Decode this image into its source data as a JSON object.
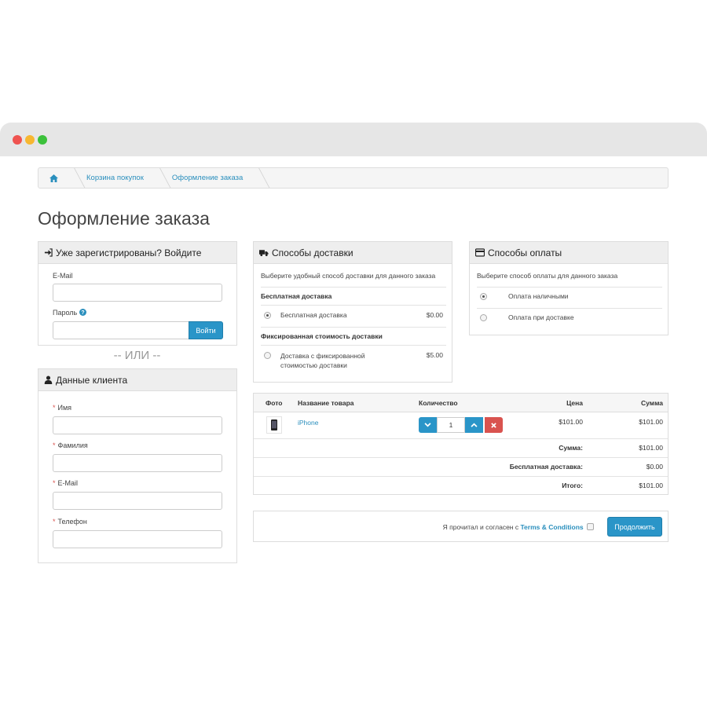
{
  "breadcrumb": {
    "home_icon": "home-icon",
    "items": [
      "Корзина покупок",
      "Оформление заказа"
    ]
  },
  "page_title": "Оформление заказа",
  "login": {
    "heading": "Уже зарегистрированы? Войдите",
    "heading_icon": "sign-in-icon",
    "email_label": "E-Mail",
    "email_value": "",
    "password_label": "Пароль",
    "password_help_icon": "question-circle-icon",
    "password_value": "",
    "login_button": "Войти"
  },
  "or_text": "-- ИЛИ --",
  "customer": {
    "heading": "Данные клиента",
    "heading_icon": "user-icon",
    "required_marker": "*",
    "fields": [
      {
        "label": "Имя",
        "value": ""
      },
      {
        "label": "Фамилия",
        "value": ""
      },
      {
        "label": "E-Mail",
        "value": ""
      },
      {
        "label": "Телефон",
        "value": ""
      }
    ]
  },
  "shipping": {
    "heading": "Способы доставки",
    "heading_icon": "truck-icon",
    "description": "Выберите удобный способ доставки для данного заказа",
    "groups": [
      {
        "title": "Бесплатная доставка",
        "option": "Бесплатная доставка",
        "price": "$0.00",
        "selected": true
      },
      {
        "title": "Фиксированная стоимость доставки",
        "option_line1": "Доставка с фиксированной",
        "option_line2": "стоимостью доставки",
        "price": "$5.00",
        "selected": false
      }
    ]
  },
  "payment": {
    "heading": "Способы оплаты",
    "heading_icon": "credit-card-icon",
    "description": "Выберите способ оплаты для данного заказа",
    "options": [
      {
        "label": "Оплата наличными",
        "selected": true
      },
      {
        "label": "Оплата при доставке",
        "selected": false
      }
    ]
  },
  "cart": {
    "columns": {
      "photo": "Фото",
      "name": "Название товара",
      "qty": "Количество",
      "price": "Цена",
      "total": "Сумма"
    },
    "items": [
      {
        "image_icon": "phone-icon",
        "name": "iPhone",
        "qty": "1",
        "price": "$101.00",
        "total": "$101.00"
      }
    ],
    "qty_buttons": {
      "decrease_icon": "chevron-down-icon",
      "increase_icon": "chevron-up-icon",
      "remove_icon": "close-icon"
    },
    "totals": [
      {
        "label": "Сумма:",
        "value": "$101.00"
      },
      {
        "label": "Бесплатная доставка:",
        "value": "$0.00"
      },
      {
        "label": "Итого:",
        "value": "$101.00"
      }
    ]
  },
  "confirm": {
    "agree_text": "Я прочитал и согласен с",
    "terms_link": "Terms & Conditions",
    "continue_button": "Продолжить"
  },
  "colors": {
    "accent": "#2a95c8",
    "danger": "#d9534f",
    "link": "#2a8fbd"
  }
}
